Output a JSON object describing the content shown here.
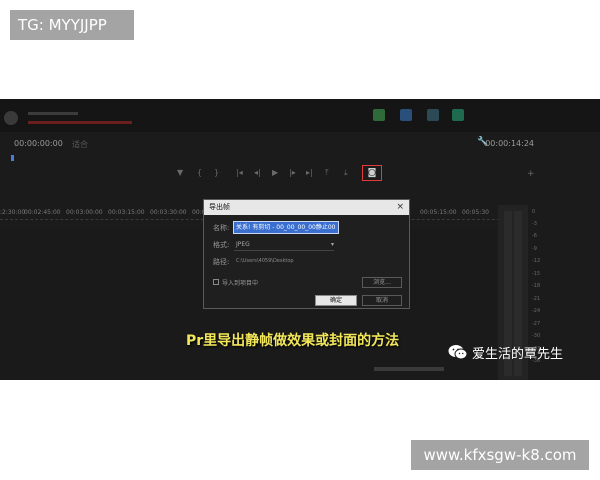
{
  "overlay": {
    "tg_label": "TG: MYYJJPP",
    "watermark_url": "www.kfxsgw-k8.com"
  },
  "timeline": {
    "timecode_left": "00:00:00:00",
    "fit_label": "适合",
    "timecode_right": "00:00:14:24",
    "ruler_ticks": [
      ":2:30:00",
      "00:02:45:00",
      "00:03:00:00",
      "00:03:15:00",
      "00:03:30:00",
      "00:03:45:00",
      "00:05:15:00",
      "00:05:30"
    ]
  },
  "meter_scale": [
    "0",
    "-3",
    "-6",
    "-9",
    "-12",
    "-15",
    "-18",
    "-21",
    "-24",
    "-27",
    "-30",
    "-33",
    "-36"
  ],
  "dialog": {
    "title": "导出帧",
    "close_glyph": "×",
    "name_label": "名称:",
    "name_value": "关系! 有剪切 - 00_00_00_00静止00",
    "format_label": "格式:",
    "format_value": "JPEG",
    "path_label": "路径:",
    "path_value": "C:\\Users\\4059\\Desktop",
    "import_label": "导入到项目中",
    "browse_label": "浏览...",
    "ok_label": "确定",
    "cancel_label": "取消"
  },
  "caption": "Pr里导出静帧做效果或封面的方法",
  "brand": {
    "wechat_name": "爱生活的覃先生"
  },
  "colors": {
    "highlight_red": "#e03a3a",
    "caption_yellow": "#f2e65a",
    "selection_blue": "#3a6fd0"
  }
}
